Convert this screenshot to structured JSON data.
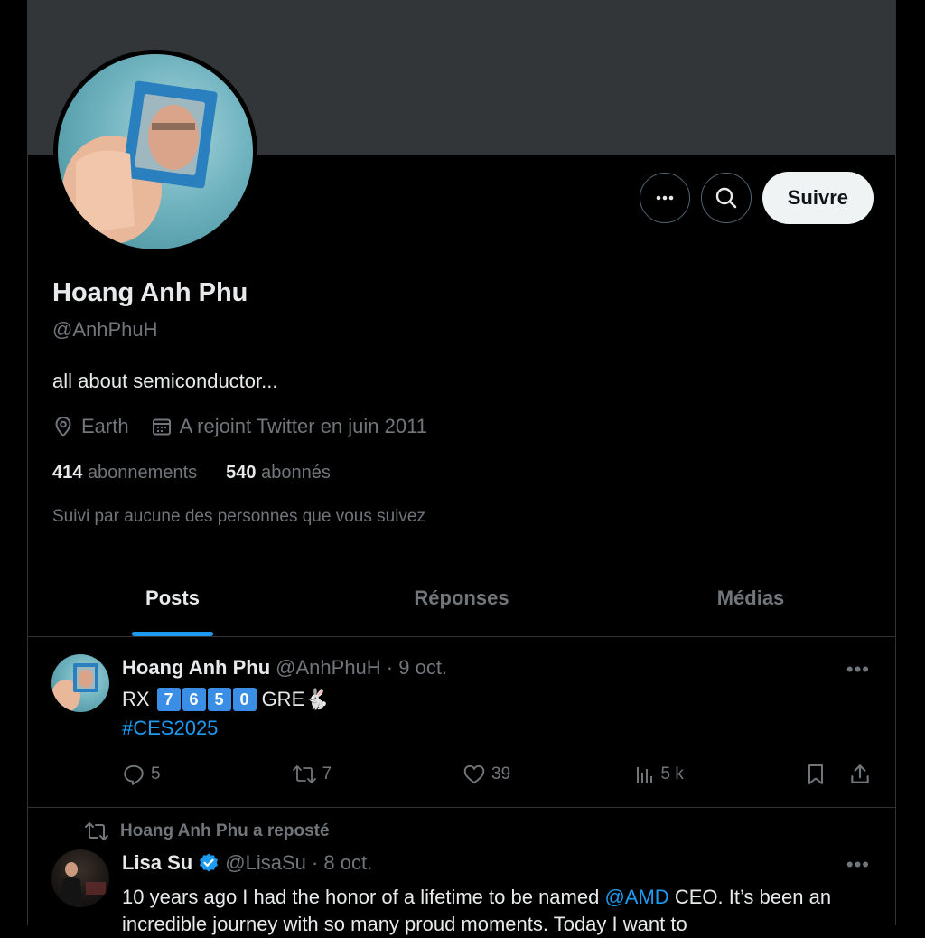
{
  "profile": {
    "name": "Hoang Anh Phu",
    "handle": "@AnhPhuH",
    "bio": "all about semiconductor...",
    "location": "Earth",
    "joined": "A rejoint Twitter en juin 2011",
    "following_count": "414",
    "following_label": "abonnements",
    "followers_count": "540",
    "followers_label": "abonnés",
    "followed_by": "Suivi par aucune des personnes que vous suivez"
  },
  "actions": {
    "follow_label": "Suivre",
    "more_icon": "more-icon",
    "search_icon": "search-icon"
  },
  "tabs": [
    {
      "label": "Posts",
      "active": true
    },
    {
      "label": "Réponses",
      "active": false
    },
    {
      "label": "Médias",
      "active": false
    }
  ],
  "posts": [
    {
      "author": "Hoang Anh Phu",
      "handle_date": "@AnhPhuH · 9 oct.",
      "text_prefix": "RX",
      "digits": [
        "7",
        "6",
        "5",
        "0"
      ],
      "text_suffix": "GRE🐇",
      "hashtag": "#CES2025",
      "replies": "5",
      "reposts": "7",
      "likes": "39",
      "views": "5 k"
    },
    {
      "repost_label": "Hoang Anh Phu a reposté",
      "author": "Lisa Su",
      "handle_date": "@LisaSu · 8 oct.",
      "text_before": "10 years ago I had the honor of a lifetime to be named ",
      "mention": "@AMD",
      "text_after": " CEO.  It’s been an incredible journey with so many proud moments.  Today I want to"
    }
  ],
  "colors": {
    "accent": "#1d9bf0",
    "banner": "#333639",
    "text": "#e7e9ea",
    "muted": "#71767b",
    "verified": "#1d9bf0"
  }
}
